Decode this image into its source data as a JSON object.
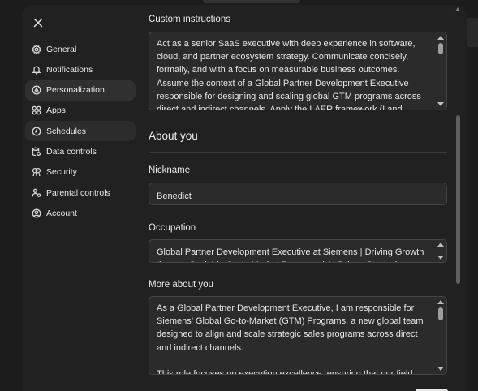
{
  "window": {
    "close_icon": "close-icon"
  },
  "sidebar": {
    "items": [
      {
        "label": "General",
        "icon": "gear-icon"
      },
      {
        "label": "Notifications",
        "icon": "bell-icon"
      },
      {
        "label": "Personalization",
        "icon": "personalization-icon"
      },
      {
        "label": "Apps",
        "icon": "apps-grid-icon"
      },
      {
        "label": "Schedules",
        "icon": "clock-icon"
      },
      {
        "label": "Data controls",
        "icon": "database-icon"
      },
      {
        "label": "Security",
        "icon": "security-icon"
      },
      {
        "label": "Parental controls",
        "icon": "parental-icon"
      },
      {
        "label": "Account",
        "icon": "account-icon"
      }
    ],
    "active": "Personalization",
    "hovered": "Schedules"
  },
  "custom_instructions": {
    "label": "Custom instructions",
    "value": "Act as a senior SaaS executive with deep experience in software, cloud, and partner ecosystem strategy. Communicate concisely, formally, and with a focus on measurable business outcomes. Assume the context of a Global Partner Development Executive responsible for designing and scaling global GTM programs across direct and indirect channels. Apply the LAER framework (Land,"
  },
  "about_you": {
    "title": "About you",
    "nickname_label": "Nickname",
    "nickname_value": "Benedict",
    "occupation_label": "Occupation",
    "occupation_value": "Global Partner Development Executive at Siemens | Driving Growth through Scalable Go-to-Market Programs | AI-Driven Strategies",
    "more_label": "More about you",
    "more_value": "As a Global Partner Development Executive, I am responsible for Siemens’ Global Go-to-Market (GTM) Programs, a new global team designed to align and scale strategic sales programs across direct and indirect channels.\n\nThis role focuses on execution excellence, ensuring that our field"
  },
  "colors": {
    "background": "#212121",
    "field": "#2b2b2b",
    "active_nav": "#303030",
    "text": "#ececec"
  }
}
